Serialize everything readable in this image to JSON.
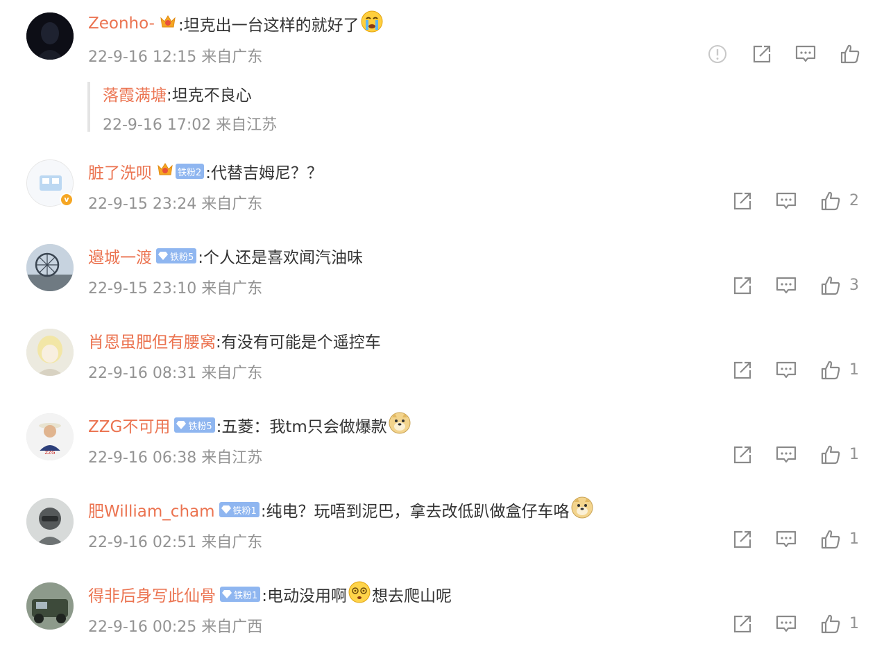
{
  "comments": [
    {
      "user": "Zeonho-",
      "text": ":坦克出一台这样的就好了",
      "meta": "22-9-16 12:15 来自广东",
      "likes": "",
      "reply": {
        "user": "落霞满塘",
        "text": ":坦克不良心",
        "meta": "22-9-16 17:02 来自江苏"
      }
    },
    {
      "user": "脏了洗呗",
      "fan_badge": "铁粉2",
      "text": ":代替吉姆尼？？",
      "meta": "22-9-15 23:24 来自广东",
      "likes": "2"
    },
    {
      "user": "邉城一渡",
      "fan_badge": "铁粉5",
      "text": ":个人还是喜欢闻汽油味",
      "meta": "22-9-15 23:10 来自广东",
      "likes": "3"
    },
    {
      "user": "肖恩虽肥但有腰窝",
      "text": ":有没有可能是个遥控车",
      "meta": "22-9-16 08:31 来自广东",
      "likes": "1"
    },
    {
      "user": "ZZG不可用",
      "fan_badge": "铁粉5",
      "text": ":五菱：我tm只会做爆款",
      "meta": "22-9-16 06:38 来自江苏",
      "likes": "1"
    },
    {
      "user": "肥William_cham",
      "fan_badge": "铁粉1",
      "text": ":纯电？玩唔到泥巴，拿去改低趴做盒仔车咯",
      "meta": "22-9-16 02:51 来自广东",
      "likes": "1"
    },
    {
      "user": "得非后身写此仙骨",
      "fan_badge": "铁粉1",
      "text_a": ":电动没用啊",
      "text_b": "想去爬山呢",
      "meta": "22-9-16 00:25 来自广西",
      "likes": "1"
    }
  ],
  "colors": {
    "username": "#eb7350",
    "meta": "#939393",
    "fan_badge": "#8fb6f0",
    "verified": "#f5a623"
  },
  "icons": [
    "report-icon",
    "share-icon",
    "comment-icon",
    "like-icon",
    "crown-icon",
    "diamond-icon",
    "crying-emoji",
    "doge-emoji",
    "dizzy-emoji"
  ]
}
